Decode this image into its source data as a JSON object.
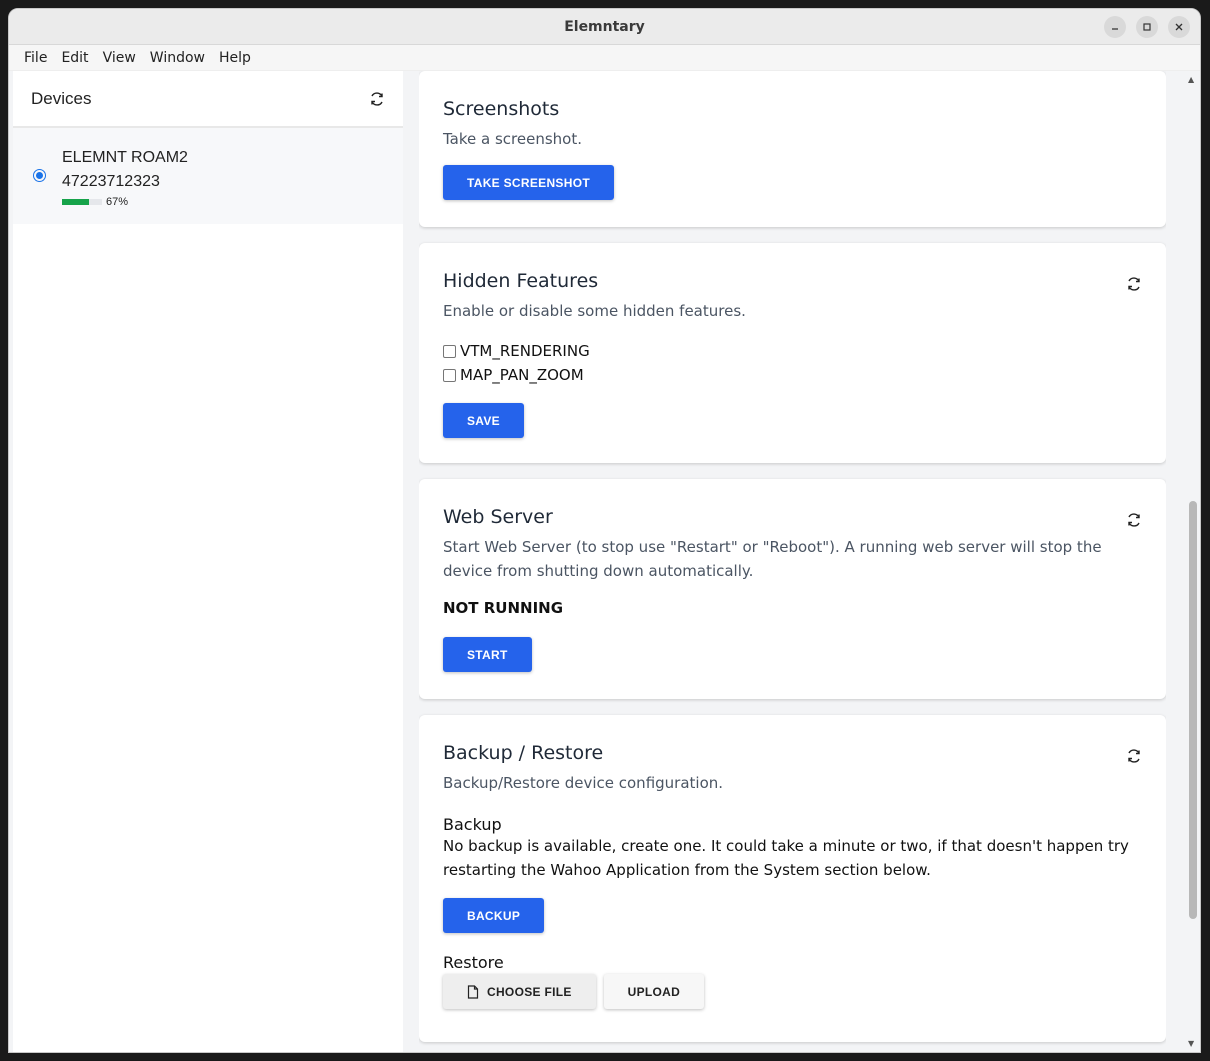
{
  "window": {
    "title": "Elemntary"
  },
  "menu": [
    "File",
    "Edit",
    "View",
    "Window",
    "Help"
  ],
  "sidebar": {
    "title": "Devices",
    "device": {
      "name": "ELEMNT ROAM2",
      "serial": "47223712323",
      "battery_label": "67%",
      "battery_fraction": 0.67
    }
  },
  "screenshots": {
    "title": "Screenshots",
    "description": "Take a screenshot.",
    "button": "TAKE SCREENSHOT"
  },
  "hidden_features": {
    "title": "Hidden Features",
    "description": "Enable or disable some hidden features.",
    "options": [
      "VTM_RENDERING",
      "MAP_PAN_ZOOM"
    ],
    "button": "SAVE"
  },
  "web_server": {
    "title": "Web Server",
    "description": "Start Web Server (to stop use \"Restart\" or \"Reboot\"). A running web server will stop the device from shutting down automatically.",
    "status": "NOT RUNNING",
    "button": "START"
  },
  "backup_restore": {
    "title": "Backup / Restore",
    "description": "Backup/Restore device configuration.",
    "backup_label": "Backup",
    "backup_text": "No backup is available, create one. It could take a minute or two, if that doesn't happen try restarting the Wahoo Application from the System section below.",
    "backup_button": "BACKUP",
    "restore_label": "Restore",
    "choose_file_button": "CHOOSE FILE",
    "upload_button": "UPLOAD"
  },
  "colors": {
    "accent": "#2563eb",
    "battery": "#16a34a"
  }
}
